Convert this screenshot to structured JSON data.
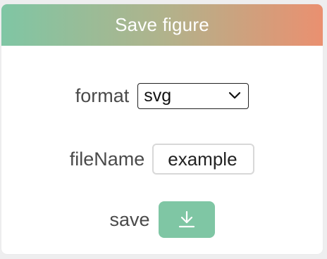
{
  "dialog": {
    "title": "Save figure"
  },
  "format": {
    "label": "format",
    "selected": "svg"
  },
  "file_name": {
    "label": "fileName",
    "value": "example"
  },
  "save": {
    "label": "save",
    "icon": "download-icon"
  },
  "colors": {
    "accent": "#7fc6a4",
    "gradient_start": "#7fc6a4",
    "gradient_end": "#ea9070"
  }
}
